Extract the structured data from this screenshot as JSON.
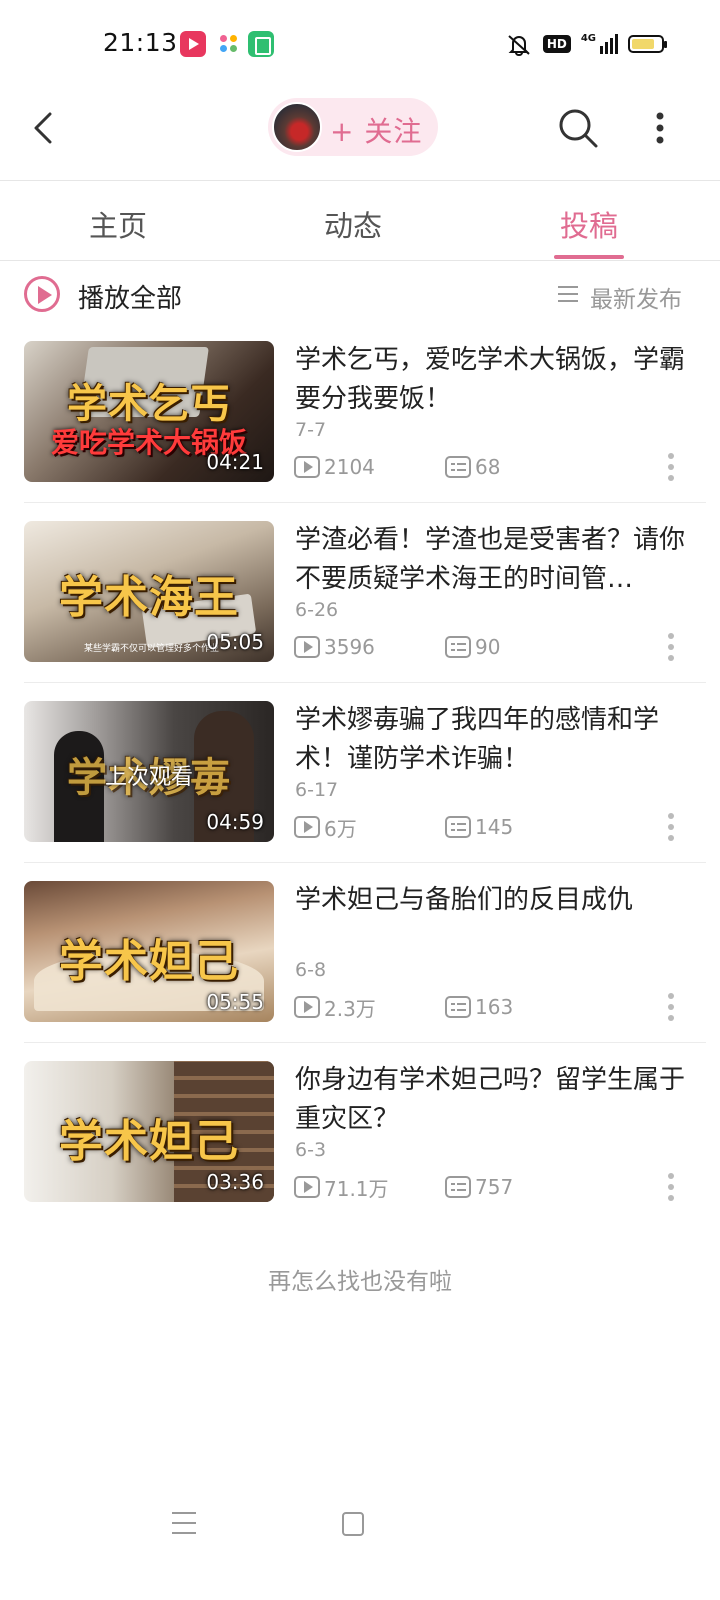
{
  "status_bar": {
    "time": "21:13",
    "network_label": "4G",
    "hd_label": "HD",
    "battery_level": 0.8,
    "battery_color": "#f1d86a",
    "icons": [
      "video-app-icon",
      "photos-app-icon",
      "store-app-icon",
      "mute-icon",
      "hd-icon",
      "signal-icon",
      "battery-icon"
    ]
  },
  "header": {
    "follow_label": "+ 关注",
    "accent_color": "#e06c91"
  },
  "tabs": [
    {
      "label": "主页",
      "active": false
    },
    {
      "label": "动态",
      "active": false
    },
    {
      "label": "投稿",
      "active": true
    }
  ],
  "toolbar": {
    "play_all_label": "播放全部",
    "sort_label": "最新发布"
  },
  "videos": [
    {
      "title": "学术乞丐，爱吃学术大锅饭，学霸要分我要饭！",
      "date": "7-7",
      "views": "2104",
      "danmaku": "68",
      "duration": "04:21",
      "thumb_text": "学术乞丐",
      "thumb_subtext": "爱吃学术大锅饭"
    },
    {
      "title": "学渣必看！学渣也是受害者？请你不要质疑学术海王的时间管…",
      "date": "6-26",
      "views": "3596",
      "danmaku": "90",
      "duration": "05:05",
      "thumb_text": "学术海王",
      "thumb_caption": "某些学霸不仅可以管理好多个作业"
    },
    {
      "title": "学术嫪毐骗了我四年的感情和学术！谨防学术诈骗！",
      "date": "6-17",
      "views": "6万",
      "danmaku": "145",
      "duration": "04:59",
      "thumb_text": "学术嫪毐",
      "thumb_overlay": "上次观看"
    },
    {
      "title": "学术妲己与备胎们的反目成仇",
      "date": "6-8",
      "views": "2.3万",
      "danmaku": "163",
      "duration": "05:55",
      "thumb_text": "学术妲己"
    },
    {
      "title": "你身边有学术妲己吗？留学生属于重灾区？",
      "date": "6-3",
      "views": "71.1万",
      "danmaku": "757",
      "duration": "03:36",
      "thumb_text": "学术妲己"
    }
  ],
  "end_text": "再怎么找也没有啦"
}
